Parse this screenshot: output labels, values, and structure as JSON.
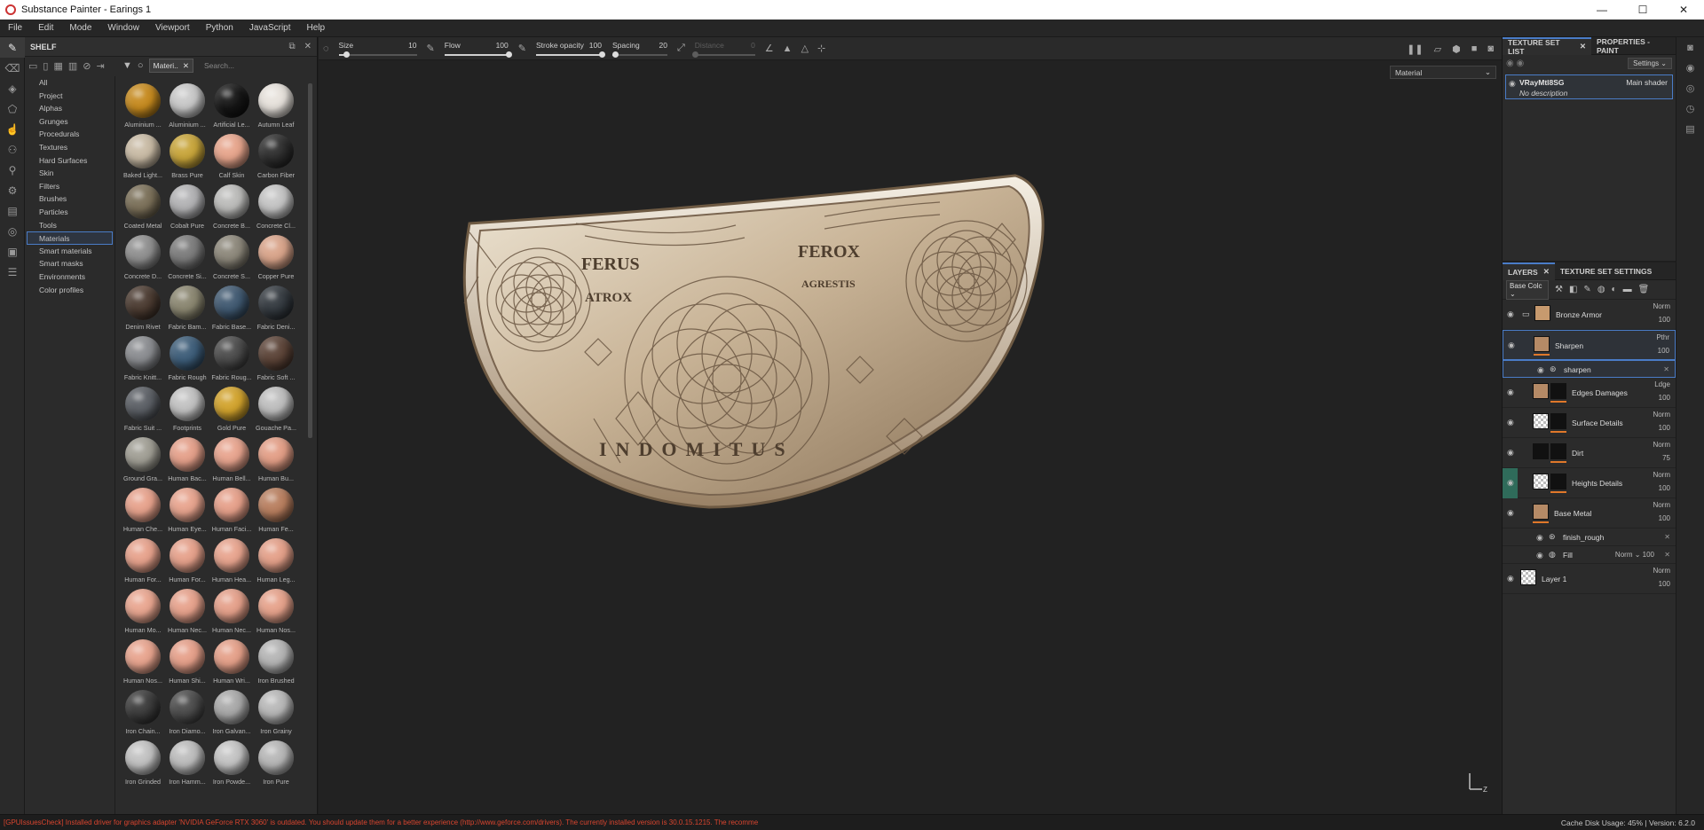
{
  "window": {
    "title": "Substance Painter - Earings 1",
    "min": "—",
    "max": "☐",
    "close": "✕"
  },
  "menu": [
    "File",
    "Edit",
    "Mode",
    "Window",
    "Viewport",
    "Python",
    "JavaScript",
    "Help"
  ],
  "shelf": {
    "title": "SHELF",
    "categories": [
      "All",
      "Project",
      "Alphas",
      "Grunges",
      "Procedurals",
      "Textures",
      "Hard Surfaces",
      "Skin",
      "Filters",
      "Brushes",
      "Particles",
      "Tools",
      "Materials",
      "Smart materials",
      "Smart masks",
      "Environments",
      "Color profiles"
    ],
    "selected_category": "Materials",
    "filter_chip": "Materi..",
    "search_placeholder": "Search...",
    "materials": [
      {
        "name": "Aluminium ...",
        "color": "#c68a1e"
      },
      {
        "name": "Aluminium ...",
        "color": "#c9c9c9"
      },
      {
        "name": "Artificial Le...",
        "color": "#151515"
      },
      {
        "name": "Autumn Leaf",
        "color": "#e7e2dc"
      },
      {
        "name": "Baked Light...",
        "color": "#c9bba5"
      },
      {
        "name": "Brass Pure",
        "color": "#c8a53a"
      },
      {
        "name": "Calf Skin",
        "color": "#e7a58c"
      },
      {
        "name": "Carbon Fiber",
        "color": "#2d2d2d"
      },
      {
        "name": "Coated Metal",
        "color": "#7a6f58"
      },
      {
        "name": "Cobalt Pure",
        "color": "#b3b3b5"
      },
      {
        "name": "Concrete B...",
        "color": "#bcbcba"
      },
      {
        "name": "Concrete Cl...",
        "color": "#c5c5c5"
      },
      {
        "name": "Concrete D...",
        "color": "#8f8f8f"
      },
      {
        "name": "Concrete Si...",
        "color": "#7b7b7b"
      },
      {
        "name": "Concrete S...",
        "color": "#8c877a"
      },
      {
        "name": "Copper Pure",
        "color": "#d9a48a"
      },
      {
        "name": "Denim Rivet",
        "color": "#4a3a30"
      },
      {
        "name": "Fabric Bam...",
        "color": "#8a8670"
      },
      {
        "name": "Fabric Base...",
        "color": "#3f5870"
      },
      {
        "name": "Fabric Deni...",
        "color": "#33393f"
      },
      {
        "name": "Fabric Knitt...",
        "color": "#8a8c90"
      },
      {
        "name": "Fabric Rough",
        "color": "#3c5c78"
      },
      {
        "name": "Fabric Roug...",
        "color": "#4a4a4a"
      },
      {
        "name": "Fabric Soft ...",
        "color": "#5a4236"
      },
      {
        "name": "Fabric Suit ...",
        "color": "#5a5e64"
      },
      {
        "name": "Footprints",
        "color": "#c2c2c2"
      },
      {
        "name": "Gold Pure",
        "color": "#d2a32c"
      },
      {
        "name": "Gouache Pa...",
        "color": "#bfbfbf"
      },
      {
        "name": "Ground Gra...",
        "color": "#a09e94"
      },
      {
        "name": "Human Bac...",
        "color": "#e5a08a"
      },
      {
        "name": "Human Bell...",
        "color": "#e8a48e"
      },
      {
        "name": "Human Bu...",
        "color": "#e39e86"
      },
      {
        "name": "Human Che...",
        "color": "#e7a28c"
      },
      {
        "name": "Human Eye...",
        "color": "#e8a48e"
      },
      {
        "name": "Human Faci...",
        "color": "#e6a08a"
      },
      {
        "name": "Human Fe...",
        "color": "#b87e5e"
      },
      {
        "name": "Human For...",
        "color": "#e7a28c"
      },
      {
        "name": "Human For...",
        "color": "#e6a18b"
      },
      {
        "name": "Human Hea...",
        "color": "#e8a48e"
      },
      {
        "name": "Human Leg...",
        "color": "#e4a089"
      },
      {
        "name": "Human Mo...",
        "color": "#e9a690"
      },
      {
        "name": "Human Nec...",
        "color": "#e7a28c"
      },
      {
        "name": "Human Nec...",
        "color": "#e5a08a"
      },
      {
        "name": "Human Nos...",
        "color": "#e6a28b"
      },
      {
        "name": "Human Nos...",
        "color": "#e8a48e"
      },
      {
        "name": "Human Shi...",
        "color": "#e6a08a"
      },
      {
        "name": "Human Wri...",
        "color": "#e5a089"
      },
      {
        "name": "Iron Brushed",
        "color": "#b5b5b5"
      },
      {
        "name": "Iron Chain...",
        "color": "#3a3a3a"
      },
      {
        "name": "Iron Diamo...",
        "color": "#4a4a4a"
      },
      {
        "name": "Iron Galvan...",
        "color": "#a9a9a9"
      },
      {
        "name": "Iron Grainy",
        "color": "#b8b8b8"
      },
      {
        "name": "Iron Grinded",
        "color": "#c2c2c2"
      },
      {
        "name": "Iron Hamm...",
        "color": "#bdbdbd"
      },
      {
        "name": "Iron Powde...",
        "color": "#c4c4c4"
      },
      {
        "name": "Iron Pure",
        "color": "#b7b7b7"
      }
    ]
  },
  "toolbar": {
    "size_label": "Size",
    "size_value": "10",
    "flow_label": "Flow",
    "flow_value": "100",
    "stroke_label": "Stroke opacity",
    "stroke_value": "100",
    "spacing_label": "Spacing",
    "spacing_value": "20",
    "distance_label": "Distance",
    "distance_value": "0",
    "size_level": 0.1,
    "flow_level": 1.0,
    "stroke_level": 1.0,
    "spacing_level": 0.05,
    "distance_level": 0.0
  },
  "viewport": {
    "channel_dropdown": "Material",
    "coin_text": {
      "ferus": "FERUS",
      "ferox": "FEROX",
      "atrox": "ATROX",
      "agrestis": "AGRESTIS",
      "indomitus": "INDOMITUS"
    }
  },
  "texture_set_list": {
    "tab_label": "TEXTURE SET LIST",
    "other_tab": "PROPERTIES - PAINT",
    "settings_label": "Settings",
    "item_name": "VRayMtl8SG",
    "item_desc": "No description",
    "item_shader": "Main shader"
  },
  "layers": {
    "tab_label": "LAYERS",
    "other_tab": "TEXTURE SET SETTINGS",
    "channel_select": "Base Colc",
    "rows": [
      {
        "name": "Bronze Armor",
        "blend": "Norm",
        "opacity": "100"
      },
      {
        "name": "Sharpen",
        "blend": "Pthr",
        "opacity": "100"
      },
      {
        "name": "sharpen"
      },
      {
        "name": "Edges Damages",
        "blend": "Ldge",
        "opacity": "100"
      },
      {
        "name": "Surface Details",
        "blend": "Norm",
        "opacity": "100"
      },
      {
        "name": "Dirt",
        "blend": "Norm",
        "opacity": "75"
      },
      {
        "name": "Heights Details",
        "blend": "Norm",
        "opacity": "100"
      },
      {
        "name": "Base Metal",
        "blend": "Norm",
        "opacity": "100"
      },
      {
        "name": "finish_rough"
      },
      {
        "name": "Fill",
        "blend": "Norm",
        "opacity": "100"
      },
      {
        "name": "Layer 1",
        "blend": "Norm",
        "opacity": "100"
      }
    ]
  },
  "status": {
    "message": "[GPUIssuesCheck] Installed driver for graphics adapter 'NVIDIA GeForce RTX 3060' is outdated. You should update them for a better experience (http://www.geforce.com/drivers). The currently installed version is 30.0.15.1215. The recomme",
    "cache": "Cache Disk Usage:",
    "cache_value": "45%",
    "version": "Version: 6.2.0"
  },
  "colors": {
    "accent": "#4a7cc7",
    "status_error": "#d9452f",
    "mask_bar": "#e0782a"
  }
}
